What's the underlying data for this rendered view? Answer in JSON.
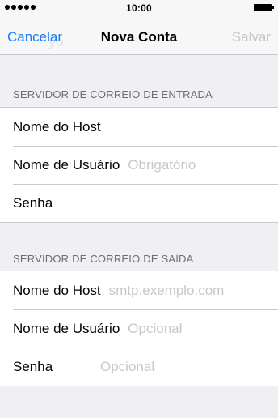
{
  "status_bar": {
    "time": "10:00",
    "signal_icon": "signal-dots-icon",
    "battery_icon": "battery-icon"
  },
  "nav": {
    "cancel_label": "Cancelar",
    "title": "Nova Conta",
    "save_label": "Salvar",
    "ghost_text": "ygo    ...",
    "cancel_color": "#1a7cf9",
    "save_color": "#c7c7cc"
  },
  "incoming": {
    "header": "SERVIDOR DE CORREIO DE ENTRADA",
    "rows": [
      {
        "label": "Nome do Host",
        "value": "",
        "placeholder": ""
      },
      {
        "label": "Nome de Usuário",
        "value": "",
        "placeholder": "Obrigatório"
      },
      {
        "label": "Senha",
        "value": "",
        "placeholder": ""
      }
    ]
  },
  "outgoing": {
    "header": "SERVIDOR DE CORREIO DE SAÍDA",
    "rows": [
      {
        "label": "Nome do Host",
        "value": "",
        "placeholder": "smtp.exemplo.com"
      },
      {
        "label": "Nome de Usuário",
        "value": "",
        "placeholder": "Opcional"
      },
      {
        "label": "Senha",
        "value": "",
        "placeholder": "Opcional"
      }
    ]
  }
}
